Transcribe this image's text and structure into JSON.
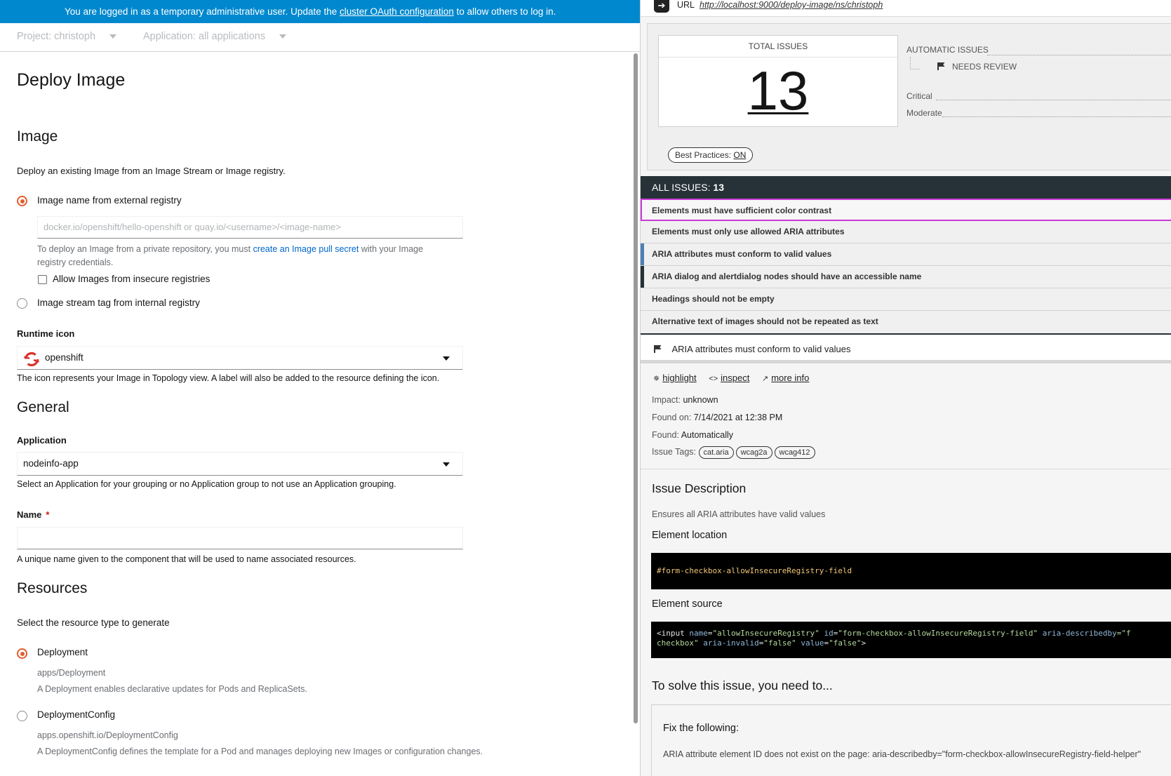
{
  "banner": {
    "text_before": "You are logged in as a temporary administrative user. Update the ",
    "link": "cluster OAuth configuration",
    "text_after": " to allow others to log in."
  },
  "context": {
    "project": "Project: christoph",
    "application": "Application: all applications"
  },
  "form": {
    "title": "Deploy Image",
    "image_section": {
      "heading": "Image",
      "description": "Deploy an existing Image from an Image Stream or Image registry.",
      "option_external": "Image name from external registry",
      "external_placeholder": "docker.io/openshift/hello-openshift or quay.io/<username>/<image-name>",
      "help_before": "To deploy an Image from a private repository, you must ",
      "help_link": "create an Image pull secret",
      "help_after": " with your Image",
      "help_line2": "registry credentials.",
      "insecure_label": "Allow Images from insecure registries",
      "option_internal": "Image stream tag from internal registry"
    },
    "runtime_icon": {
      "label": "Runtime icon",
      "value": "openshift",
      "help": "The icon represents your Image in Topology view. A label will also be added to the resource defining the icon."
    },
    "general": {
      "heading": "General",
      "app_label": "Application",
      "app_value": "nodeinfo-app",
      "app_help": "Select an Application for your grouping or no Application group to not use an Application grouping.",
      "name_label": "Name",
      "name_required": "*",
      "name_help": "A unique name given to the component that will be used to name associated resources."
    },
    "resources": {
      "heading": "Resources",
      "description": "Select the resource type to generate",
      "deployment_label": "Deployment",
      "deployment_type": "apps/Deployment",
      "deployment_desc": "A Deployment enables declarative updates for Pods and ReplicaSets.",
      "dc_label": "DeploymentConfig",
      "dc_type": "apps.openshift.io/DeploymentConfig",
      "dc_desc": "A DeploymentConfig defines the template for a Pod and manages deploying new Images or configuration changes."
    }
  },
  "a11y_panel": {
    "url_label": "URL",
    "url": "http://localhost:9000/deploy-image/ns/christoph",
    "total_label": "TOTAL ISSUES",
    "total_value": "13",
    "automatic_label": "AUTOMATIC ISSUES",
    "needs_review_label": "NEEDS REVIEW",
    "critical_label": "Critical",
    "moderate_label": "Moderate",
    "best_practices_label": "Best Practices: ",
    "best_practices_value": "ON",
    "all_issues_label": "ALL ISSUES: ",
    "all_issues_count": "13",
    "issues": [
      "Elements must have sufficient color contrast",
      "Elements must only use allowed ARIA attributes",
      "ARIA attributes must conform to valid values",
      "ARIA dialog and alertdialog nodes should have an accessible name",
      "Headings should not be empty",
      "Alternative text of images should not be repeated as text"
    ],
    "detail": {
      "title": "ARIA attributes must conform to valid values",
      "action_highlight": "highlight",
      "action_inspect": "inspect",
      "action_more": "more info",
      "impact_label": "Impact:",
      "impact_value": "unknown",
      "found_on_label": "Found on:",
      "found_on_value": "7/14/2021 at 12:38 PM",
      "found_label": "Found:",
      "found_value": "Automatically",
      "tags_label": "Issue Tags:",
      "tags": [
        "cat.aria",
        "wcag2a",
        "wcag412"
      ],
      "desc_heading": "Issue Description",
      "desc_text": "Ensures all ARIA attributes have valid values",
      "location_heading": "Element location",
      "location_code": "#form-checkbox-allowInsecureRegistry-field",
      "source_heading": "Element source",
      "source_line1": {
        "open": "<input",
        "a1": "name",
        "v1": "\"allowInsecureRegistry\"",
        "a2": "id",
        "v2": "\"form-checkbox-allowInsecureRegistry-field\"",
        "a3": "aria-describedby",
        "v3": "=\"f"
      },
      "source_line2": {
        "v0": "checkbox\"",
        "a1": "aria-invalid",
        "v1": "\"false\"",
        "a2": "value",
        "v2": "\"false\"",
        "close": ">"
      },
      "solve_heading": "To solve this issue, you need to...",
      "fix_heading": "Fix the following:",
      "fix_text": "ARIA attribute element ID does not exist on the page: aria-describedby=\"form-checkbox-allowInsecureRegistry-field-helper\""
    }
  },
  "colors": {
    "banner": "#0088ce",
    "accent_radio": "#e35d2e",
    "link": "#0066cc",
    "issues_header": "#263238",
    "selected_outline": "#c93bd6",
    "bar_blue": "#4f7fb5"
  }
}
